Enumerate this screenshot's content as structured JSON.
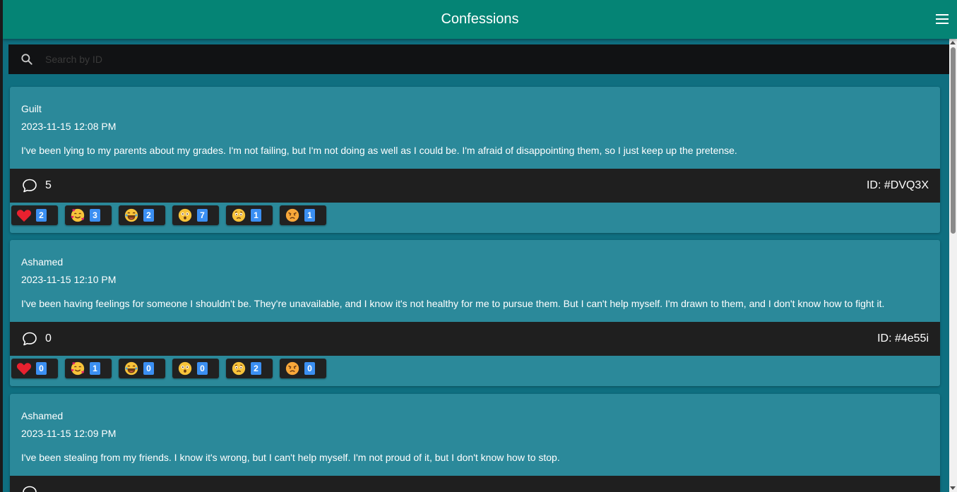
{
  "app": {
    "title": "Confessions"
  },
  "search": {
    "placeholder": "Search by ID",
    "value": ""
  },
  "posts": [
    {
      "category": "Guilt",
      "date": "2023-11-15 12:08 PM",
      "text": "I've been lying to my parents about my grades. I'm not failing, but I'm not doing as well as I could be. I'm afraid of disappointing them, so I just keep up the pretense.",
      "comments": "5",
      "id": "ID: #DVQ3X",
      "reactions": [
        {
          "name": "heart",
          "count": "2"
        },
        {
          "name": "smiling-face-with-hearts",
          "count": "3"
        },
        {
          "name": "laughing",
          "count": "2"
        },
        {
          "name": "astonished",
          "count": "7"
        },
        {
          "name": "crying",
          "count": "1"
        },
        {
          "name": "angry",
          "count": "1"
        }
      ]
    },
    {
      "category": "Ashamed",
      "date": "2023-11-15 12:10 PM",
      "text": "I've been having feelings for someone I shouldn't be. They're unavailable, and I know it's not healthy for me to pursue them. But I can't help myself. I'm drawn to them, and I don't know how to fight it.",
      "comments": "0",
      "id": "ID: #4e55i",
      "reactions": [
        {
          "name": "heart",
          "count": "0"
        },
        {
          "name": "smiling-face-with-hearts",
          "count": "1"
        },
        {
          "name": "laughing",
          "count": "0"
        },
        {
          "name": "astonished",
          "count": "0"
        },
        {
          "name": "crying",
          "count": "2"
        },
        {
          "name": "angry",
          "count": "0"
        }
      ]
    },
    {
      "category": "Ashamed",
      "date": "2023-11-15 12:09 PM",
      "text": "I've been stealing from my friends. I know it's wrong, but I can't help myself. I'm not proud of it, but I don't know how to stop.",
      "comments": "",
      "id": "",
      "reactions": []
    }
  ],
  "colors": {
    "appbar": "#058475",
    "card": "#2b899a",
    "footer": "#1f1f1f",
    "badge": "#3b8ff2"
  }
}
